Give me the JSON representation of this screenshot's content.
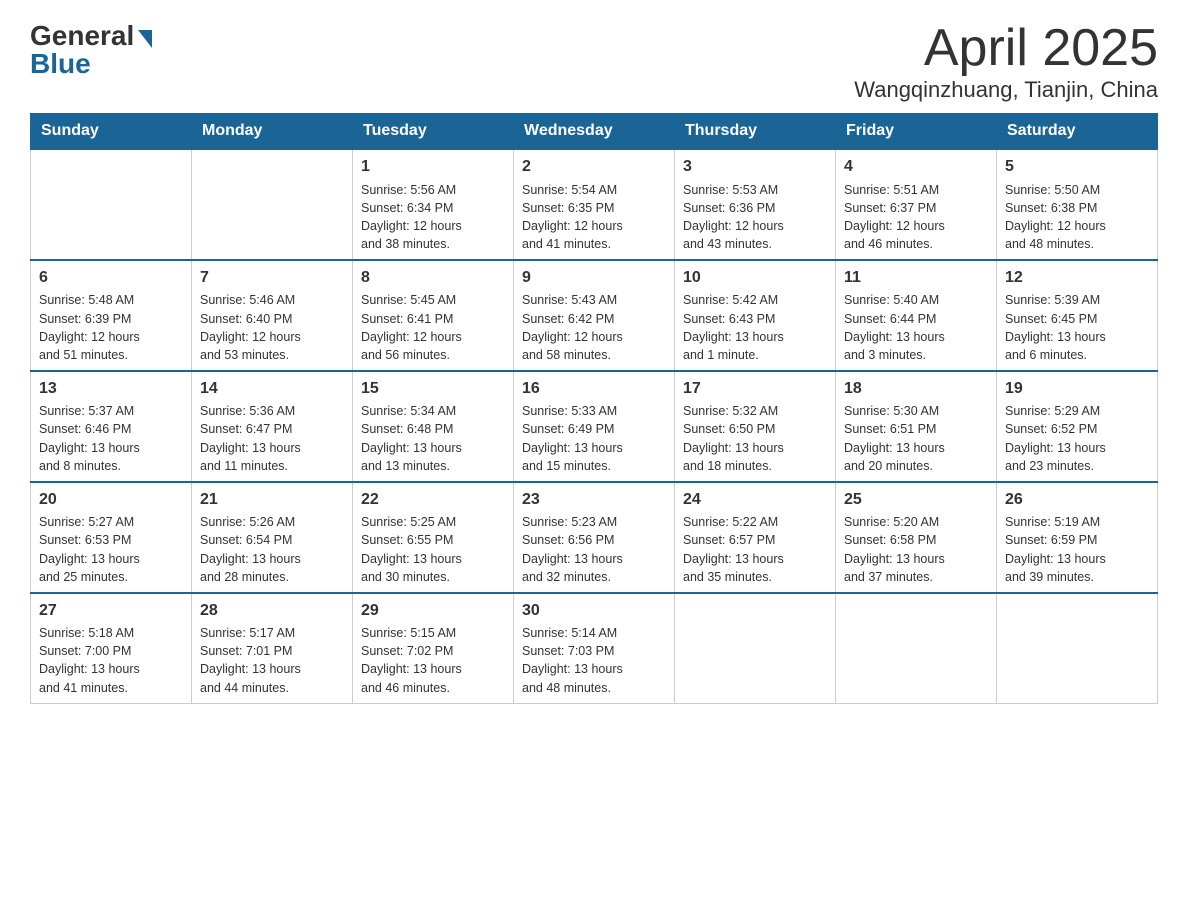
{
  "logo": {
    "general": "General",
    "blue": "Blue"
  },
  "title": "April 2025",
  "location": "Wangqinzhuang, Tianjin, China",
  "days_of_week": [
    "Sunday",
    "Monday",
    "Tuesday",
    "Wednesday",
    "Thursday",
    "Friday",
    "Saturday"
  ],
  "weeks": [
    [
      {
        "day": "",
        "info": ""
      },
      {
        "day": "",
        "info": ""
      },
      {
        "day": "1",
        "info": "Sunrise: 5:56 AM\nSunset: 6:34 PM\nDaylight: 12 hours\nand 38 minutes."
      },
      {
        "day": "2",
        "info": "Sunrise: 5:54 AM\nSunset: 6:35 PM\nDaylight: 12 hours\nand 41 minutes."
      },
      {
        "day": "3",
        "info": "Sunrise: 5:53 AM\nSunset: 6:36 PM\nDaylight: 12 hours\nand 43 minutes."
      },
      {
        "day": "4",
        "info": "Sunrise: 5:51 AM\nSunset: 6:37 PM\nDaylight: 12 hours\nand 46 minutes."
      },
      {
        "day": "5",
        "info": "Sunrise: 5:50 AM\nSunset: 6:38 PM\nDaylight: 12 hours\nand 48 minutes."
      }
    ],
    [
      {
        "day": "6",
        "info": "Sunrise: 5:48 AM\nSunset: 6:39 PM\nDaylight: 12 hours\nand 51 minutes."
      },
      {
        "day": "7",
        "info": "Sunrise: 5:46 AM\nSunset: 6:40 PM\nDaylight: 12 hours\nand 53 minutes."
      },
      {
        "day": "8",
        "info": "Sunrise: 5:45 AM\nSunset: 6:41 PM\nDaylight: 12 hours\nand 56 minutes."
      },
      {
        "day": "9",
        "info": "Sunrise: 5:43 AM\nSunset: 6:42 PM\nDaylight: 12 hours\nand 58 minutes."
      },
      {
        "day": "10",
        "info": "Sunrise: 5:42 AM\nSunset: 6:43 PM\nDaylight: 13 hours\nand 1 minute."
      },
      {
        "day": "11",
        "info": "Sunrise: 5:40 AM\nSunset: 6:44 PM\nDaylight: 13 hours\nand 3 minutes."
      },
      {
        "day": "12",
        "info": "Sunrise: 5:39 AM\nSunset: 6:45 PM\nDaylight: 13 hours\nand 6 minutes."
      }
    ],
    [
      {
        "day": "13",
        "info": "Sunrise: 5:37 AM\nSunset: 6:46 PM\nDaylight: 13 hours\nand 8 minutes."
      },
      {
        "day": "14",
        "info": "Sunrise: 5:36 AM\nSunset: 6:47 PM\nDaylight: 13 hours\nand 11 minutes."
      },
      {
        "day": "15",
        "info": "Sunrise: 5:34 AM\nSunset: 6:48 PM\nDaylight: 13 hours\nand 13 minutes."
      },
      {
        "day": "16",
        "info": "Sunrise: 5:33 AM\nSunset: 6:49 PM\nDaylight: 13 hours\nand 15 minutes."
      },
      {
        "day": "17",
        "info": "Sunrise: 5:32 AM\nSunset: 6:50 PM\nDaylight: 13 hours\nand 18 minutes."
      },
      {
        "day": "18",
        "info": "Sunrise: 5:30 AM\nSunset: 6:51 PM\nDaylight: 13 hours\nand 20 minutes."
      },
      {
        "day": "19",
        "info": "Sunrise: 5:29 AM\nSunset: 6:52 PM\nDaylight: 13 hours\nand 23 minutes."
      }
    ],
    [
      {
        "day": "20",
        "info": "Sunrise: 5:27 AM\nSunset: 6:53 PM\nDaylight: 13 hours\nand 25 minutes."
      },
      {
        "day": "21",
        "info": "Sunrise: 5:26 AM\nSunset: 6:54 PM\nDaylight: 13 hours\nand 28 minutes."
      },
      {
        "day": "22",
        "info": "Sunrise: 5:25 AM\nSunset: 6:55 PM\nDaylight: 13 hours\nand 30 minutes."
      },
      {
        "day": "23",
        "info": "Sunrise: 5:23 AM\nSunset: 6:56 PM\nDaylight: 13 hours\nand 32 minutes."
      },
      {
        "day": "24",
        "info": "Sunrise: 5:22 AM\nSunset: 6:57 PM\nDaylight: 13 hours\nand 35 minutes."
      },
      {
        "day": "25",
        "info": "Sunrise: 5:20 AM\nSunset: 6:58 PM\nDaylight: 13 hours\nand 37 minutes."
      },
      {
        "day": "26",
        "info": "Sunrise: 5:19 AM\nSunset: 6:59 PM\nDaylight: 13 hours\nand 39 minutes."
      }
    ],
    [
      {
        "day": "27",
        "info": "Sunrise: 5:18 AM\nSunset: 7:00 PM\nDaylight: 13 hours\nand 41 minutes."
      },
      {
        "day": "28",
        "info": "Sunrise: 5:17 AM\nSunset: 7:01 PM\nDaylight: 13 hours\nand 44 minutes."
      },
      {
        "day": "29",
        "info": "Sunrise: 5:15 AM\nSunset: 7:02 PM\nDaylight: 13 hours\nand 46 minutes."
      },
      {
        "day": "30",
        "info": "Sunrise: 5:14 AM\nSunset: 7:03 PM\nDaylight: 13 hours\nand 48 minutes."
      },
      {
        "day": "",
        "info": ""
      },
      {
        "day": "",
        "info": ""
      },
      {
        "day": "",
        "info": ""
      }
    ]
  ]
}
